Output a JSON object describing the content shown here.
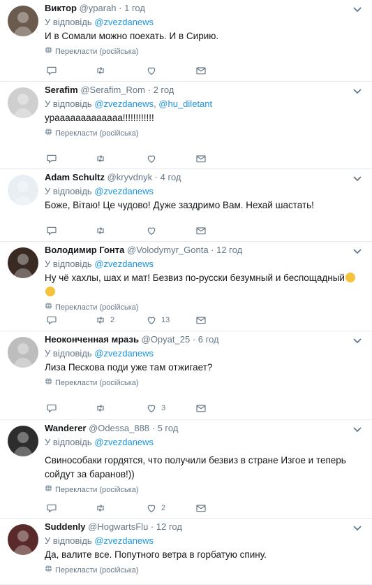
{
  "reply_prefix": "У відповідь",
  "translate_label": "Перекласти (російська)",
  "colors": {
    "link": "#1b95e0",
    "muted": "#657786",
    "divider": "#e6ecf0"
  },
  "tweets": [
    {
      "name": "Виктор",
      "handle": "@yparah",
      "time": "1 год",
      "reply_to": [
        "@zvezdanews"
      ],
      "text": "И в Сомали можно поехать. И в Сирию.",
      "translate": true,
      "counts": {
        "reply": "",
        "retweet": "",
        "like": ""
      }
    },
    {
      "name": "Serafim",
      "handle": "@Serafim_Rom",
      "time": "2 год",
      "reply_to": [
        "@zvezdanews",
        "@hu_diletant"
      ],
      "text": "урааааааааааааа!!!!!!!!!!!!",
      "translate": true,
      "counts": {
        "reply": "",
        "retweet": "",
        "like": ""
      }
    },
    {
      "name": "Adam Schultz",
      "handle": "@kryvdnyk",
      "time": "4 год",
      "reply_to": [
        "@zvezdanews"
      ],
      "text": "Боже, Вітаю! Це чудово! Дуже заздримо Вам. Нехай шастать!",
      "translate": false,
      "counts": {
        "reply": "",
        "retweet": "",
        "like": ""
      }
    },
    {
      "name": "Володимир Гонта",
      "handle": "@Volodymyr_Gonta",
      "time": "12 год",
      "reply_to": [
        "@zvezdanews"
      ],
      "text": "Ну чё хахлы, шах и мат! Безвиз по-русски безумный и беспощадный",
      "translate": true,
      "emoji": [
        "face-with-tears-of-joy",
        "rolling-on-floor-laughing"
      ],
      "counts": {
        "reply": "",
        "retweet": "2",
        "like": "13"
      }
    },
    {
      "name": "Неоконченная мразь",
      "handle": "@Opyat_25",
      "time": "6 год",
      "reply_to": [
        "@zvezdanews"
      ],
      "text": "Лиза Пескова поди уже там отжигает?",
      "translate": true,
      "counts": {
        "reply": "",
        "retweet": "",
        "like": "3"
      }
    },
    {
      "name": "Wanderer",
      "handle": "@Odessa_888",
      "time": "5 год",
      "reply_to": [
        "@zvezdanews"
      ],
      "text": "Свиноcобаки  гордятся, что получили безвиз в стране Изгое и теперь сойдут за баранов!))",
      "translate": true,
      "counts": {
        "reply": "",
        "retweet": "",
        "like": "2"
      }
    },
    {
      "name": "Suddenly",
      "handle": "@HogwartsFlu",
      "time": "12 год",
      "reply_to": [
        "@zvezdanews"
      ],
      "text": "Да, валите все. Попутного ветра в горбатую спину.",
      "translate": true,
      "counts": {
        "reply": "",
        "retweet": "",
        "like": ""
      }
    }
  ]
}
